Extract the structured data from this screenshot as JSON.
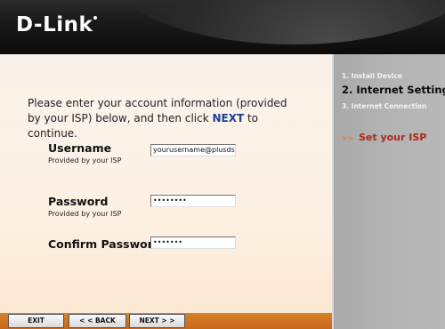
{
  "header": {
    "brand": "D-Link"
  },
  "intro": {
    "text_before": "Please enter your account information (provided by your ISP) below, and then click ",
    "next_word": "NEXT",
    "text_after": " to continue."
  },
  "form": {
    "username": {
      "label": "Username",
      "hint": "Provided by your ISP",
      "value": "yourusername@plusdsl.net"
    },
    "password": {
      "label": "Password",
      "hint": "Provided by your ISP",
      "value": "••••••••"
    },
    "confirm": {
      "label": "Confirm Password",
      "value": "•••••••"
    }
  },
  "sidebar": {
    "steps": [
      {
        "label": "1.  Install Device"
      },
      {
        "label": "2.  Internet Setting"
      },
      {
        "label": "3.  Internet Connection"
      }
    ],
    "current_sub": {
      "prefix": ">>",
      "label": "Set your ISP"
    }
  },
  "buttons": {
    "exit": "EXIT",
    "back": "< < BACK",
    "next": "NEXT > >"
  },
  "colors": {
    "accent_orange": "#d8822a",
    "link_blue": "#1a3f9a",
    "sub_red": "#b0261a"
  }
}
